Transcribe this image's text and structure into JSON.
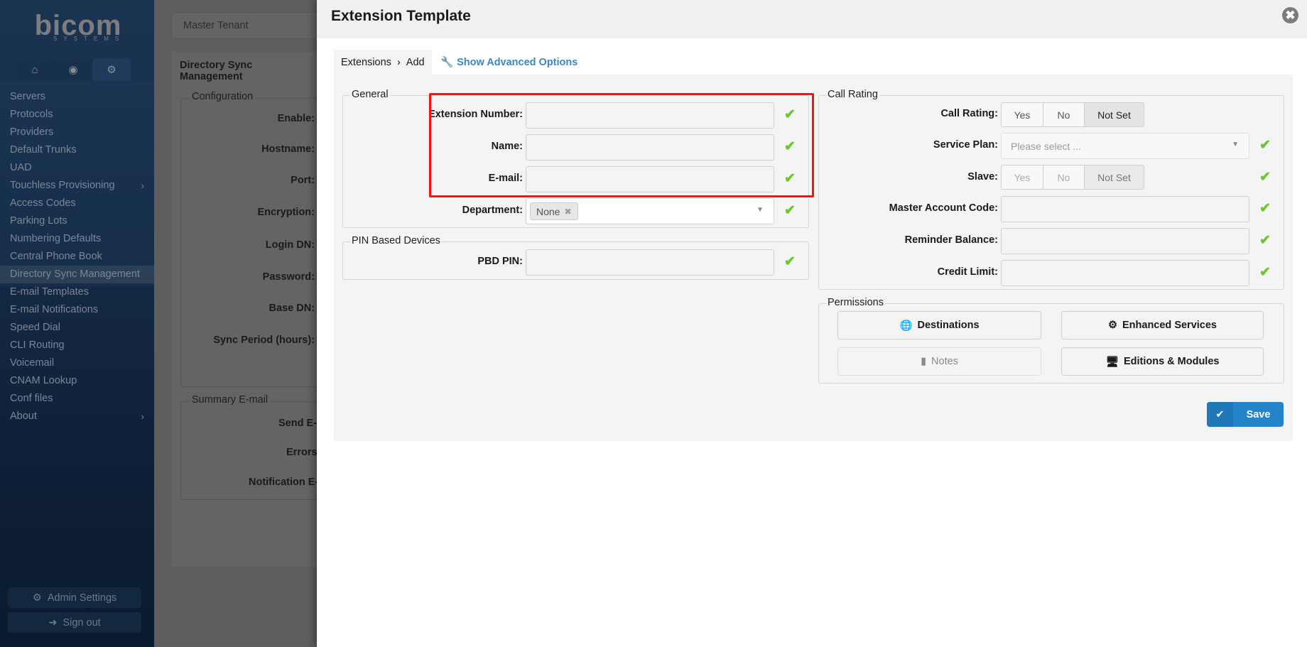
{
  "sidebar": {
    "logo": "bicom",
    "logo_sub": "SYSTEMS",
    "tabs": [
      "home-icon",
      "support-icon",
      "settings-icon"
    ],
    "items": [
      {
        "label": "Servers"
      },
      {
        "label": "Protocols"
      },
      {
        "label": "Providers"
      },
      {
        "label": "Default Trunks"
      },
      {
        "label": "UAD"
      },
      {
        "label": "Touchless Provisioning",
        "submenu": true
      },
      {
        "label": "Access Codes"
      },
      {
        "label": "Parking Lots"
      },
      {
        "label": "Numbering Defaults"
      },
      {
        "label": "Central Phone Book"
      },
      {
        "label": "Directory Sync Management",
        "active": true
      },
      {
        "label": "E-mail Templates"
      },
      {
        "label": "E-mail Notifications"
      },
      {
        "label": "Speed Dial"
      },
      {
        "label": "CLI Routing"
      },
      {
        "label": "Voicemail"
      },
      {
        "label": "CNAM Lookup"
      },
      {
        "label": "Conf files"
      },
      {
        "label": "About",
        "submenu": true
      }
    ],
    "admin_settings": "Admin Settings",
    "sign_out": "Sign out"
  },
  "background": {
    "tenant": "Master Tenant",
    "panel_title": "Directory Sync Management",
    "configuration_legend": "Configuration",
    "config_labels": [
      "Enable:",
      "Hostname:",
      "Port:",
      "Encryption:",
      "Login DN:",
      "Password:",
      "Base DN:",
      "Sync Period (hours):"
    ],
    "summary_legend": "Summary E-mail",
    "summary_labels": [
      "Send E-mail",
      "Errors only",
      "Notification E-mail"
    ]
  },
  "modal": {
    "title": "Extension Template",
    "breadcrumb": [
      "Extensions",
      "Add"
    ],
    "advanced_link": "Show Advanced Options",
    "general": {
      "legend": "General",
      "fields": [
        {
          "label": "Extension Number:",
          "value": ""
        },
        {
          "label": "Name:",
          "value": ""
        },
        {
          "label": "E-mail:",
          "value": ""
        }
      ],
      "department": {
        "label": "Department:",
        "value": "None"
      }
    },
    "pin": {
      "legend": "PIN Based Devices",
      "label": "PBD PIN:",
      "value": ""
    },
    "call_rating": {
      "legend": "Call Rating",
      "call_rating": {
        "label": "Call Rating:",
        "options": [
          "Yes",
          "No",
          "Not Set"
        ],
        "selected": "Not Set"
      },
      "service_plan": {
        "label": "Service Plan:",
        "placeholder": "Please select ..."
      },
      "slave": {
        "label": "Slave:",
        "options": [
          "Yes",
          "No",
          "Not Set"
        ],
        "selected": "Not Set",
        "disabled": true
      },
      "fields": [
        {
          "label": "Master Account Code:",
          "value": ""
        },
        {
          "label": "Reminder Balance:",
          "value": ""
        },
        {
          "label": "Credit Limit:",
          "value": ""
        }
      ]
    },
    "permissions": {
      "legend": "Permissions",
      "buttons": [
        {
          "label": "Destinations",
          "icon": "globe-icon"
        },
        {
          "label": "Enhanced Services",
          "icon": "gear-icon"
        },
        {
          "label": "Notes",
          "icon": "note-icon",
          "disabled": true
        },
        {
          "label": "Editions & Modules",
          "icon": "monitor-icon"
        }
      ]
    },
    "save": "Save",
    "colors": {
      "accent": "#2484c9",
      "valid": "#6cc72e",
      "highlight": "#ff1010"
    }
  }
}
